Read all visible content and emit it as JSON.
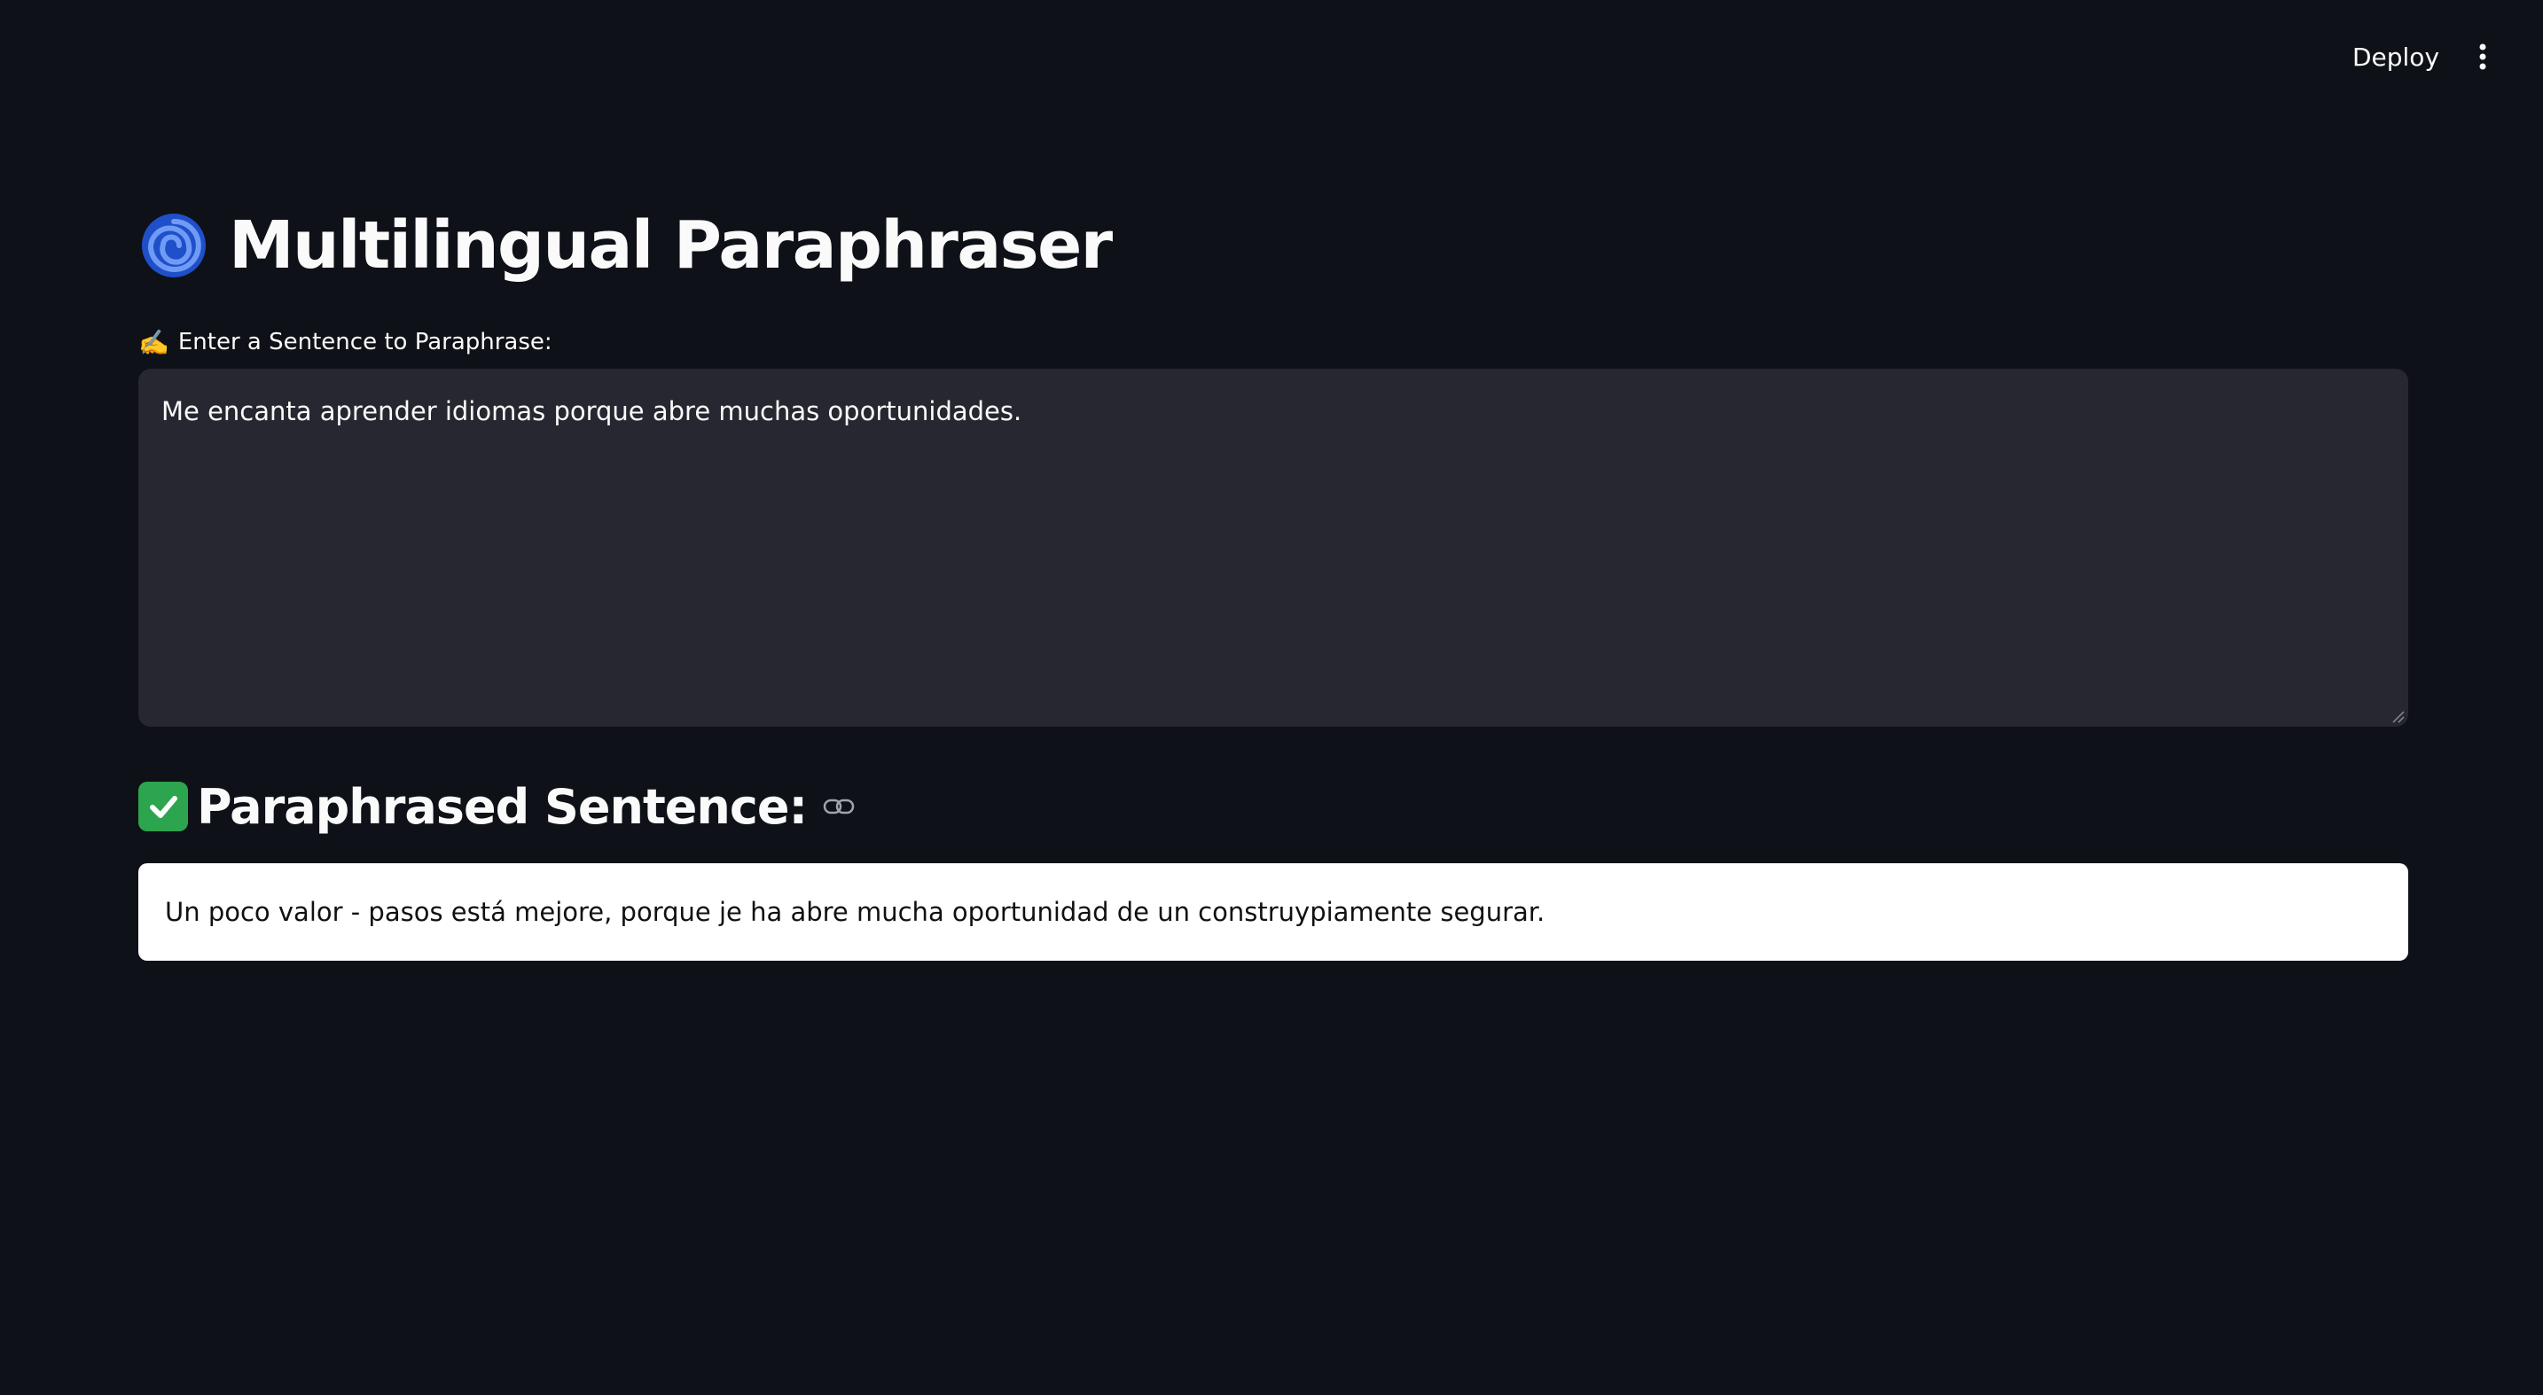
{
  "header": {
    "deploy_label": "Deploy",
    "menu_icon": "kebab-menu-icon"
  },
  "main": {
    "title_icon": "cyclone-icon",
    "title": "Multilingual Paraphraser",
    "input": {
      "label_icon": "✍️",
      "label": "Enter a Sentence to Paraphrase:",
      "value": "Me encanta aprender idiomas porque abre muchas oportunidades."
    },
    "result": {
      "heading_icon": "check-mark-icon",
      "heading": "Paraphrased Sentence:",
      "link_icon": "link-icon",
      "text": "Un poco valor - pasos está mejore, porque je ha abre mucha oportunidad de un construypiamente segurar."
    }
  },
  "colors": {
    "background": "#0e1117",
    "text_area_bg": "#262730",
    "result_bg": "#ffffff",
    "check_green": "#2da44e",
    "cyclone_blue": "#2f62d6"
  }
}
